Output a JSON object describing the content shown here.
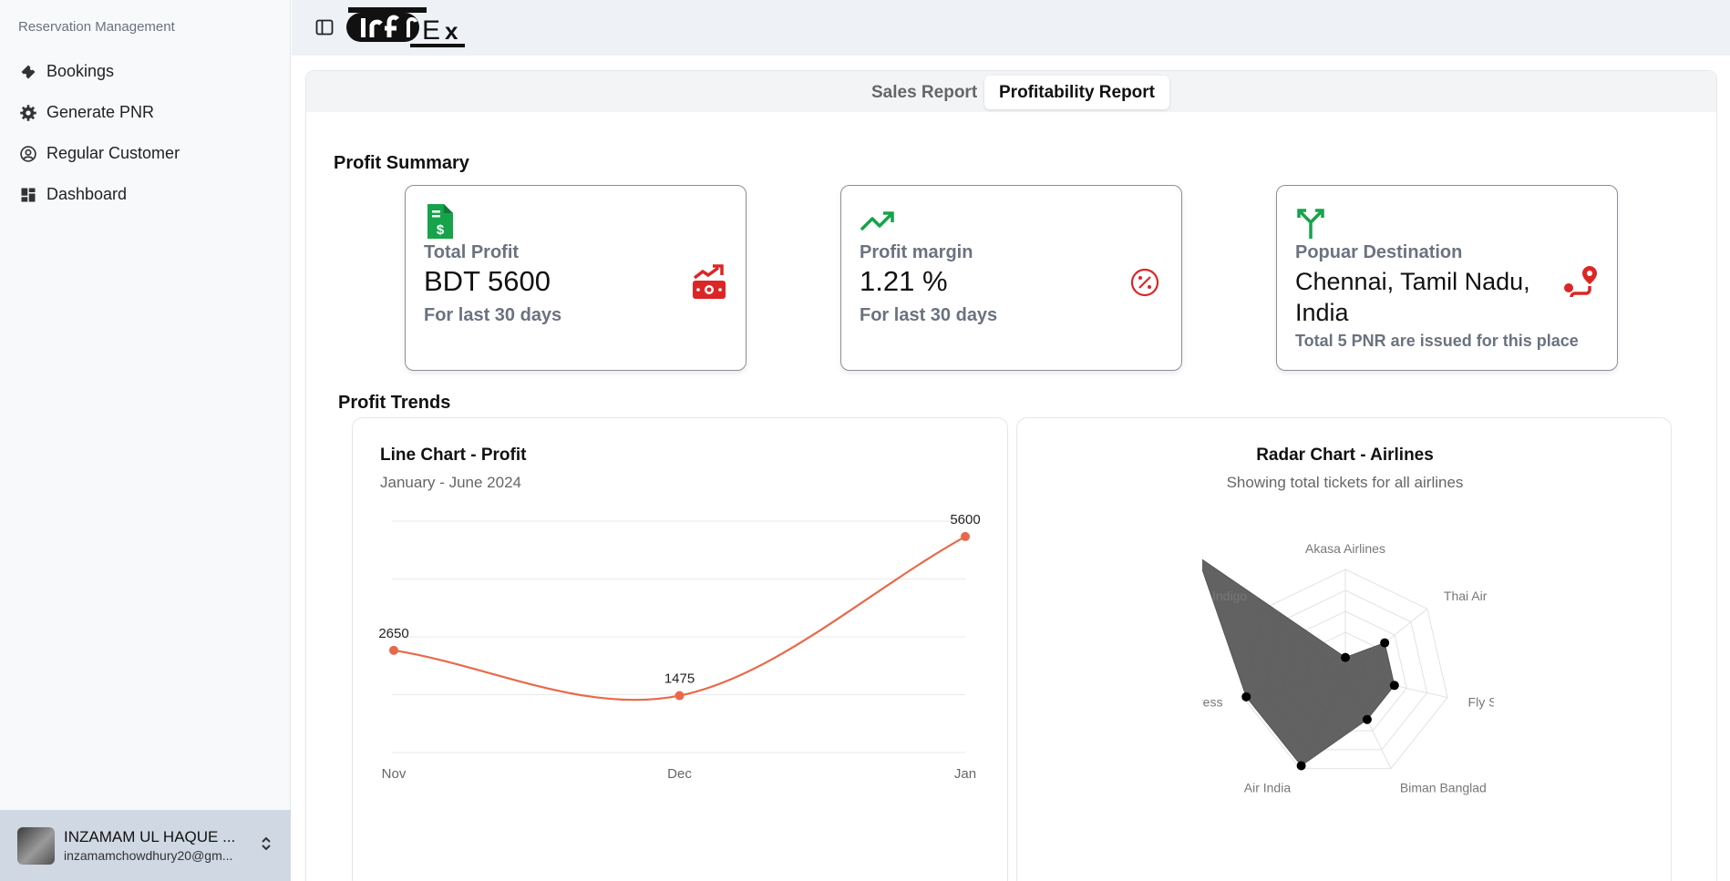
{
  "sidebar": {
    "group_label": "Reservation Management",
    "items": [
      {
        "label": "Bookings",
        "icon": "ticket-icon"
      },
      {
        "label": "Generate PNR",
        "icon": "gear-icon"
      },
      {
        "label": "Regular Customer",
        "icon": "user-circle-icon"
      },
      {
        "label": "Dashboard",
        "icon": "dashboard-icon"
      }
    ],
    "user": {
      "name": "INZAMAM UL HAQUE ...",
      "email": "inzamamchowdhury20@gm..."
    }
  },
  "header": {
    "logo_text": "IrfEx"
  },
  "tabs": [
    {
      "label": "Sales Report",
      "active": false
    },
    {
      "label": "Profitability Report",
      "active": true
    }
  ],
  "profit_summary": {
    "title": "Profit Summary",
    "cards": [
      {
        "label": "Total Profit",
        "value": "BDT 5600",
        "note": "For last 30 days"
      },
      {
        "label": "Profit margin",
        "value": "1.21 %",
        "note": "For last 30 days"
      },
      {
        "label": "Popuar Destination",
        "value": "Chennai, Tamil Nadu, India",
        "note": "Total 5 PNR are issued for this place"
      }
    ]
  },
  "profit_trends": {
    "title": "Profit Trends"
  },
  "colors": {
    "accent_green": "#16a34a",
    "accent_red": "#dc2626",
    "line": "#e8694a",
    "radar_fill": "#555555"
  },
  "chart_data": [
    {
      "type": "line",
      "title": "Line Chart - Profit",
      "subtitle": "January - June 2024",
      "categories": [
        "Nov",
        "Dec",
        "Jan"
      ],
      "values": [
        2650,
        1475,
        5600
      ],
      "data_labels": [
        "2650",
        "1475",
        "5600"
      ],
      "ylim": [
        0,
        6000
      ],
      "grid": true
    },
    {
      "type": "radar",
      "title": "Radar Chart - Airlines",
      "subtitle": "Showing total tickets for all airlines",
      "axes": [
        "Akasa Airlines",
        "Thai Airways",
        "Fly Sky",
        "Biman Bangladesh",
        "Air India",
        "Air Express",
        "Indigo"
      ],
      "axis_labels_visible": [
        "Akasa Airlines",
        "Thai Air",
        "Fly S",
        "Biman Banglad",
        "Air India",
        "press",
        "Indigo"
      ],
      "values": [
        0.16,
        0.48,
        0.48,
        0.48,
        0.97,
        0.97,
        1.8
      ],
      "grid": true
    }
  ]
}
